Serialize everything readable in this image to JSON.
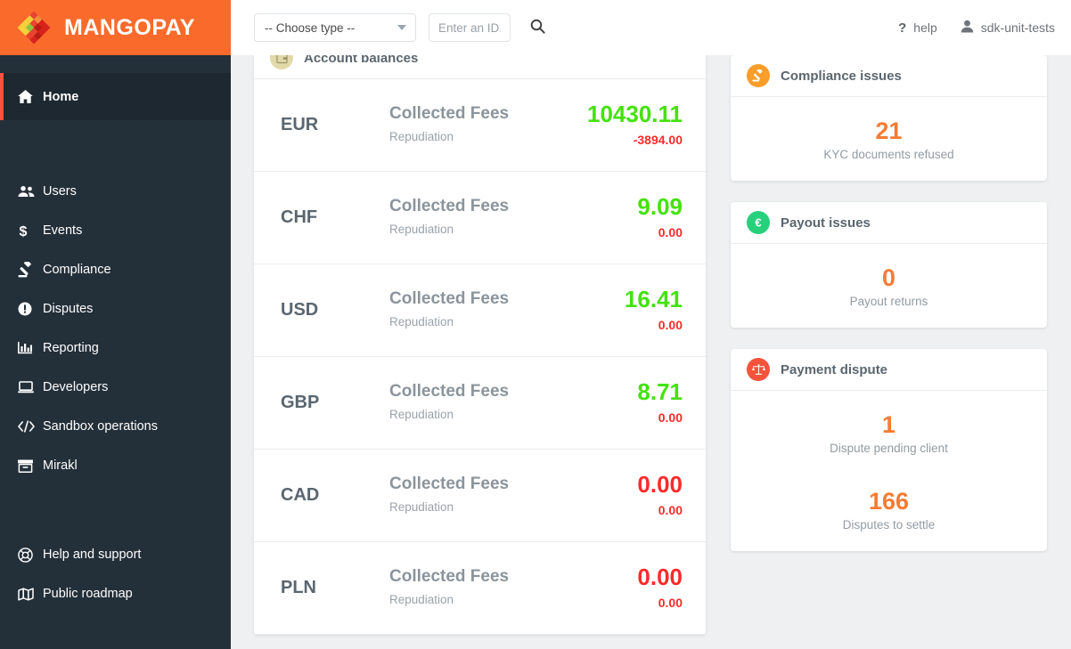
{
  "brand": {
    "name": "MANGOPAY",
    "logo_icon": "mangopay-diamond-logo",
    "color": "#f96a2b"
  },
  "topbar": {
    "type_select": {
      "value": "-- Choose type --",
      "icon": "chevron-down-icon"
    },
    "id_search": {
      "value": "",
      "placeholder": "Enter an ID..."
    },
    "search_icon": "search-icon",
    "help": {
      "label": "help",
      "icon": "question-mark-icon"
    },
    "account": {
      "label": "sdk-unit-tests",
      "icon": "user-icon"
    }
  },
  "sidebar": {
    "items": [
      {
        "label": "Home",
        "icon": "home-icon",
        "active": true
      },
      {
        "label": "Users",
        "icon": "users-icon",
        "active": false
      },
      {
        "label": "Events",
        "icon": "dollar-icon",
        "active": false
      },
      {
        "label": "Compliance",
        "icon": "gavel-icon",
        "active": false
      },
      {
        "label": "Disputes",
        "icon": "exclamation-circle-icon",
        "active": false
      },
      {
        "label": "Reporting",
        "icon": "bar-chart-icon",
        "active": false
      },
      {
        "label": "Developers",
        "icon": "laptop-icon",
        "active": false
      },
      {
        "label": "Sandbox operations",
        "icon": "code-icon",
        "active": false
      },
      {
        "label": "Mirakl",
        "icon": "archive-icon",
        "active": false
      }
    ],
    "footer_items": [
      {
        "label": "Help and support",
        "icon": "life-ring-icon"
      },
      {
        "label": "Public roadmap",
        "icon": "map-icon"
      }
    ]
  },
  "balances_panel": {
    "title": "Account balances",
    "icon": "wallet-icon",
    "row_labels": {
      "primary": "Collected Fees",
      "secondary": "Repudiation"
    },
    "rows": [
      {
        "currency": "EUR",
        "fees": "10430.11",
        "fees_sign": "pos",
        "repudiation": "-3894.00",
        "repudiation_sign": "neg"
      },
      {
        "currency": "CHF",
        "fees": "9.09",
        "fees_sign": "pos",
        "repudiation": "0.00",
        "repudiation_sign": "neg"
      },
      {
        "currency": "USD",
        "fees": "16.41",
        "fees_sign": "pos",
        "repudiation": "0.00",
        "repudiation_sign": "neg"
      },
      {
        "currency": "GBP",
        "fees": "8.71",
        "fees_sign": "pos",
        "repudiation": "0.00",
        "repudiation_sign": "neg"
      },
      {
        "currency": "CAD",
        "fees": "0.00",
        "fees_sign": "neg",
        "repudiation": "0.00",
        "repudiation_sign": "neg"
      },
      {
        "currency": "PLN",
        "fees": "0.00",
        "fees_sign": "neg",
        "repudiation": "0.00",
        "repudiation_sign": "neg"
      }
    ]
  },
  "cards": [
    {
      "title": "Compliance issues",
      "icon": "gavel-icon",
      "badge_color": "#f99d2b",
      "stats": [
        {
          "value": "21",
          "label": "KYC documents refused"
        }
      ]
    },
    {
      "title": "Payout issues",
      "icon": "euro-icon",
      "badge_color": "#27d07b",
      "stats": [
        {
          "value": "0",
          "label": "Payout returns"
        }
      ]
    },
    {
      "title": "Payment dispute",
      "icon": "balance-scale-icon",
      "badge_color": "#f4533c",
      "stats": [
        {
          "value": "1",
          "label": "Dispute pending client"
        },
        {
          "value": "166",
          "label": "Disputes to settle"
        }
      ]
    }
  ],
  "colors": {
    "brand_orange": "#f96a2b",
    "sidebar_dark": "#232f39",
    "accent_orange": "#f57c33",
    "positive_green": "#44e20d",
    "negative_red": "#fb2b2b",
    "active_bar": "#f4533c"
  }
}
